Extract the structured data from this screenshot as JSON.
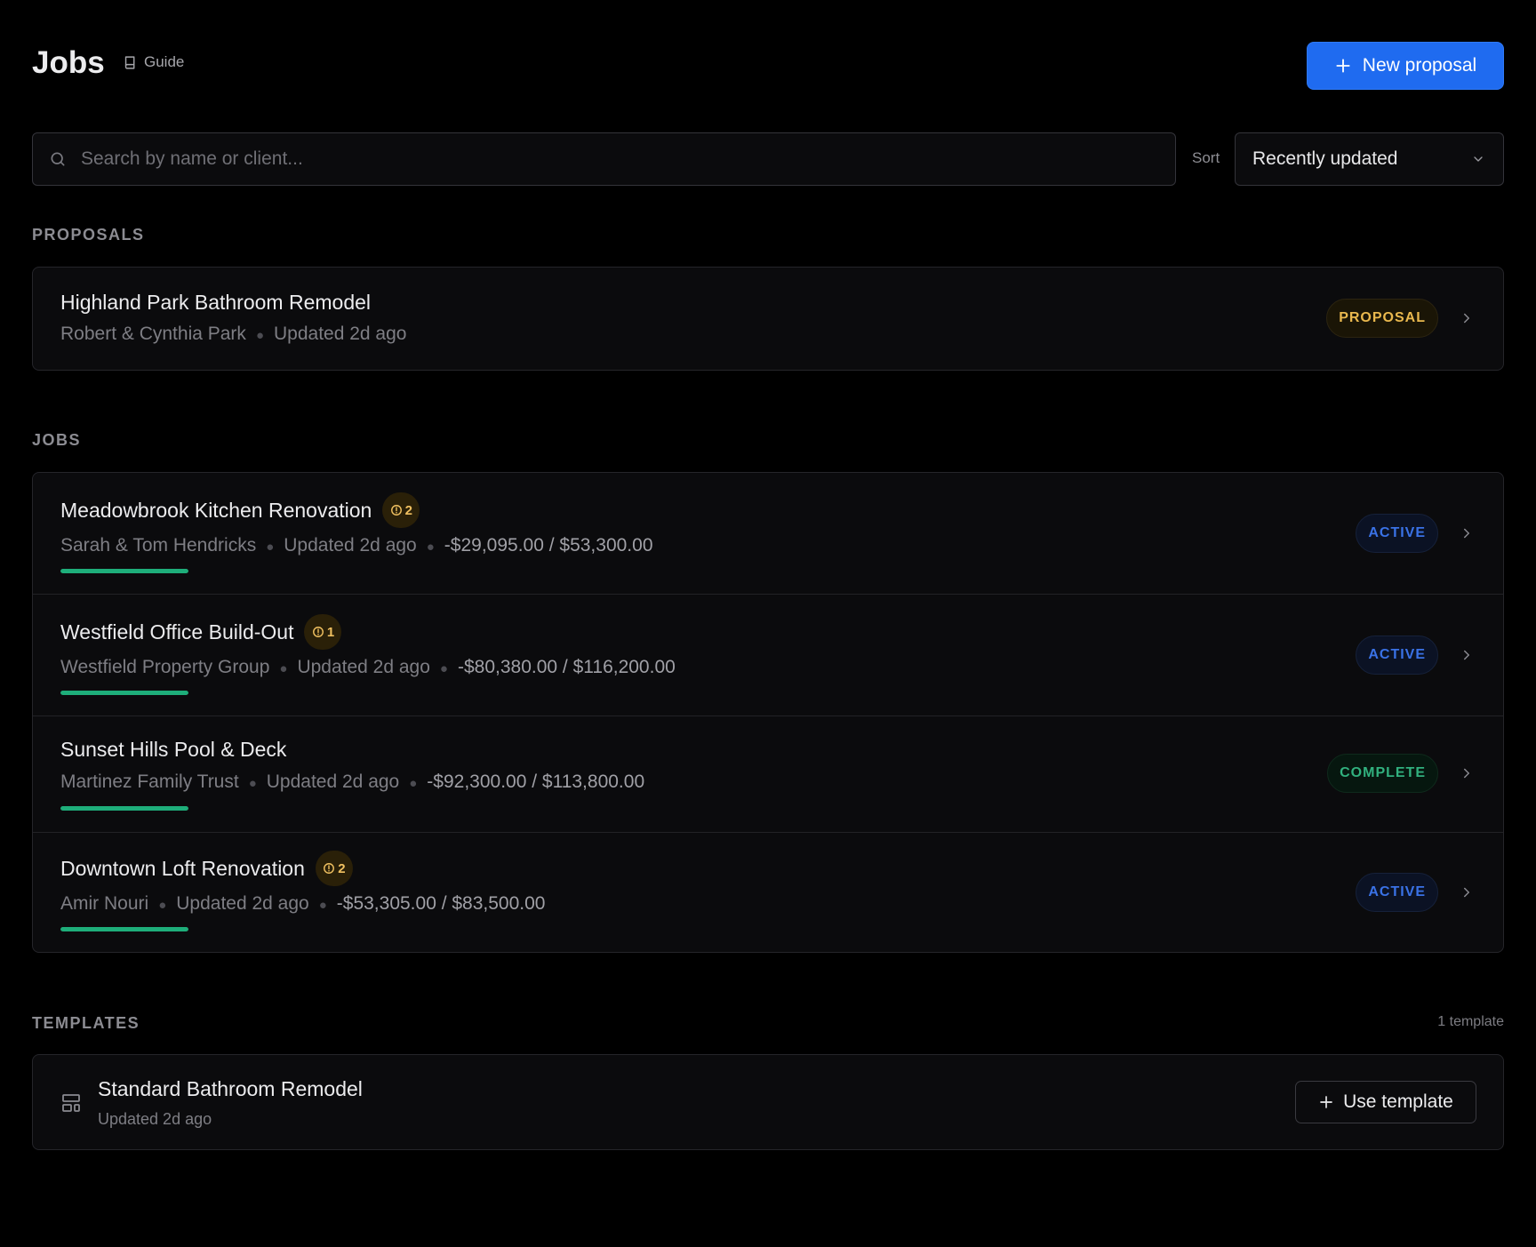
{
  "header": {
    "title": "Jobs",
    "guide_label": "Guide",
    "new_proposal_label": "New proposal"
  },
  "search": {
    "placeholder": "Search by name or client...",
    "value": ""
  },
  "sort": {
    "label": "Sort",
    "selected": "Recently updated"
  },
  "sections": {
    "proposals": "PROPOSALS",
    "jobs": "JOBS",
    "templates": "TEMPLATES",
    "templates_count": "1 template"
  },
  "proposals": [
    {
      "title": "Highland Park Bathroom Remodel",
      "client": "Robert & Cynthia Park",
      "updated": "Updated 2d ago",
      "status": "PROPOSAL"
    }
  ],
  "jobs": [
    {
      "title": "Meadowbrook Kitchen Renovation",
      "alerts": "2",
      "client": "Sarah & Tom Hendricks",
      "updated": "Updated 2d ago",
      "amount": "-$29,095.00 / $53,300.00",
      "progress": 1.0,
      "status": "ACTIVE"
    },
    {
      "title": "Westfield Office Build-Out",
      "alerts": "1",
      "client": "Westfield Property Group",
      "updated": "Updated 2d ago",
      "amount": "-$80,380.00 / $116,200.00",
      "progress": 1.0,
      "status": "ACTIVE"
    },
    {
      "title": "Sunset Hills Pool & Deck",
      "alerts": "",
      "client": "Martinez Family Trust",
      "updated": "Updated 2d ago",
      "amount": "-$92,300.00 / $113,800.00",
      "progress": 1.0,
      "status": "COMPLETE"
    },
    {
      "title": "Downtown Loft Renovation",
      "alerts": "2",
      "client": "Amir Nouri",
      "updated": "Updated 2d ago",
      "amount": "-$53,305.00 / $83,500.00",
      "progress": 1.0,
      "status": "ACTIVE"
    }
  ],
  "templates": [
    {
      "title": "Standard Bathroom Remodel",
      "updated": "Updated 2d ago",
      "button_label": "Use template"
    }
  ],
  "colors": {
    "accent": "#1f6bf0",
    "progress": "#1eae7a",
    "proposal": "#e9b84e",
    "active": "#3a72e6",
    "complete": "#31b07e",
    "alert": "#f0c060"
  },
  "icons": {
    "guide": "book-icon",
    "new": "plus-icon",
    "search": "search-icon",
    "sort": "chevron-down-icon",
    "row": "chevron-right-icon",
    "alert": "alert-circle-icon",
    "template": "layout-template-icon"
  }
}
